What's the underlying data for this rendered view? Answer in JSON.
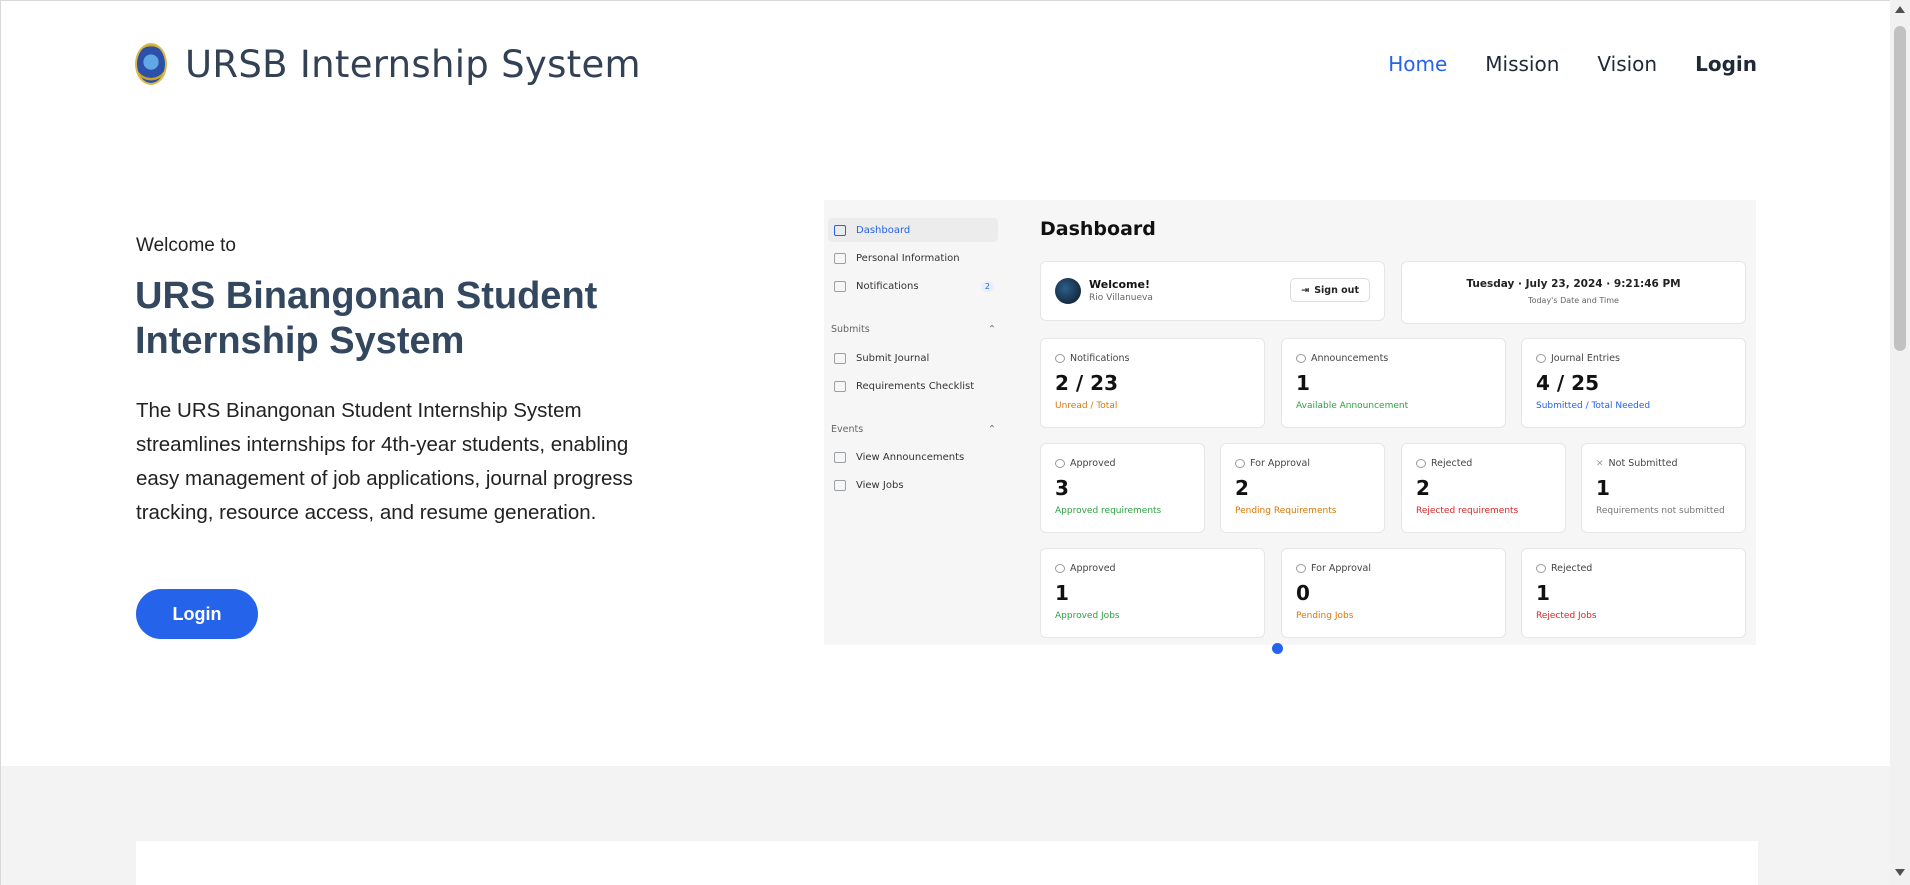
{
  "header": {
    "brand_title": "URSB Internship System",
    "nav": {
      "home": "Home",
      "mission": "Mission",
      "vision": "Vision",
      "login": "Login"
    }
  },
  "hero": {
    "welcome": "Welcome to",
    "title": "URS Binangonan Student Internship System",
    "description": "The URS Binangonan Student Internship System streamlines internships for 4th-year students, enabling easy management of job applications, journal progress tracking, resource access, and resume generation.",
    "login_button": "Login"
  },
  "preview": {
    "sidebar": {
      "dashboard": "Dashboard",
      "personal_information": "Personal Information",
      "notifications": "Notifications",
      "notifications_badge": "2",
      "submits_section": "Submits",
      "submit_journal": "Submit Journal",
      "requirements_checklist": "Requirements Checklist",
      "events_section": "Events",
      "view_announcements": "View Announcements",
      "view_jobs": "View Jobs"
    },
    "title": "Dashboard",
    "welcome_card": {
      "title": "Welcome!",
      "name": "Rio Villanueva",
      "sign_out": "Sign out"
    },
    "datetime_card": {
      "value": "Tuesday · July 23, 2024 · 9:21:46 PM",
      "label": "Today's Date and Time"
    },
    "row1": [
      {
        "label": "Notifications",
        "value": "2 / 23",
        "sub": "Unread / Total"
      },
      {
        "label": "Announcements",
        "value": "1",
        "sub": "Available Announcement"
      },
      {
        "label": "Journal Entries",
        "value": "4 / 25",
        "sub": "Submitted / Total Needed"
      }
    ],
    "row2": [
      {
        "label": "Approved",
        "value": "3",
        "sub": "Approved requirements"
      },
      {
        "label": "For Approval",
        "value": "2",
        "sub": "Pending Requirements"
      },
      {
        "label": "Rejected",
        "value": "2",
        "sub": "Rejected requirements"
      },
      {
        "label": "Not Submitted",
        "value": "1",
        "sub": "Requirements not submitted"
      }
    ],
    "row3": [
      {
        "label": "Approved",
        "value": "1",
        "sub": "Approved Jobs"
      },
      {
        "label": "For Approval",
        "value": "0",
        "sub": "Pending Jobs"
      },
      {
        "label": "Rejected",
        "value": "1",
        "sub": "Rejected Jobs"
      }
    ]
  },
  "colors": {
    "accent": "#2563eb",
    "title": "#33475f"
  }
}
